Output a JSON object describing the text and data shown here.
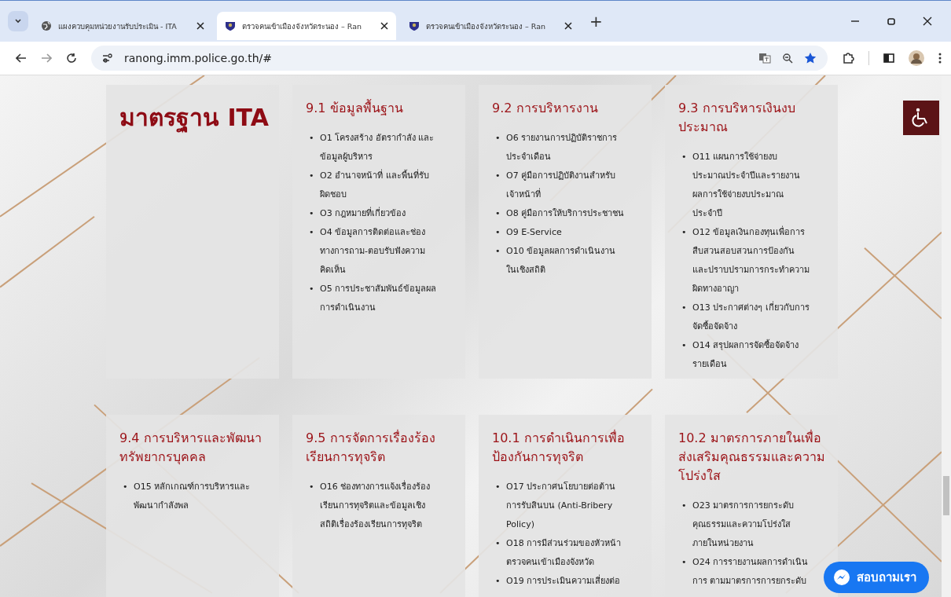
{
  "browser": {
    "tabs": [
      {
        "title": "แผงควบคุมหน่วยงานรับประเมิน - ITA",
        "selected": false,
        "kind": "globe"
      },
      {
        "title": "ตรวจคนเข้าเมืองจังหวัดระนอง – Ran",
        "selected": true,
        "kind": "shield"
      },
      {
        "title": "ตรวจคนเข้าเมืองจังหวัดระนอง – Ran",
        "selected": false,
        "kind": "shield"
      }
    ],
    "new_tab": "+",
    "address": "ranong.imm.police.go.th/#"
  },
  "page": {
    "headline": "มาตรฐาน ITA",
    "cards": [
      {
        "title": "9.1 ข้อมูลพื้นฐาน",
        "items": [
          [
            "O1 โครงสร้าง อัตรากำลัง และ",
            "ข้อมูลผู้บริหาร"
          ],
          [
            "O2 อำนาจหน้าที่ และพื้นที่รับ",
            "ผิดชอบ"
          ],
          [
            "O3 กฎหมายที่เกี่ยวข้อง"
          ],
          [
            "O4 ข้อมูลการติดต่อและช่อง",
            "ทางการถาม-ตอบรับฟังความ",
            "คิดเห็น"
          ],
          [
            "O5 การประชาสัมพันธ์ข้อมูลผล",
            "การดำเนินงาน"
          ]
        ]
      },
      {
        "title": "9.2 การบริหารงาน",
        "items": [
          [
            "O6 รายงานการปฏิบัติราชการ",
            "ประจำเดือน"
          ],
          [
            "O7 คู่มือการปฏิบัติงานสำหรับ",
            "เจ้าหน้าที่"
          ],
          [
            "O8 คู่มือการให้บริการประชาชน"
          ],
          [
            "O9 E-Service"
          ],
          [
            "O10 ข้อมูลผลการดำเนินงาน",
            "ในเชิงสถิติ"
          ]
        ]
      },
      {
        "title": "9.3 การบริหารเงินงบประมาณ",
        "items": [
          [
            "O11 แผนการใช้จ่ายงบ",
            "ประมาณประจำปีและรายงาน",
            "ผลการใช้จ่ายงบประมาณ",
            "ประจำปี"
          ],
          [
            "O12 ข้อมูลเงินกองทุนเพื่อการ",
            "สืบสวนสอบสวนการป้องกัน",
            "และปราบปรามการกระทำความ",
            "ผิดทางอาญา"
          ],
          [
            "O13 ประกาศต่างๆ เกี่ยวกับการ",
            "จัดซื้อจัดจ้าง"
          ],
          [
            "O14 สรุปผลการจัดซื้อจัดจ้าง",
            "รายเดือน"
          ]
        ]
      },
      {
        "title": "9.4 การบริหารและพัฒนาทรัพยากรบุคคล",
        "items": [
          [
            "O15 หลักเกณฑ์การบริหารและ",
            "พัฒนากำลังพล"
          ]
        ]
      },
      {
        "title": "9.5 การจัดการเรื่องร้องเรียนการทุจริต",
        "items": [
          [
            "O16 ช่องทางการแจ้งเรื่องร้อง",
            "เรียนการทุจริตและข้อมูลเชิง",
            "สถิติเรื่องร้องเรียนการทุจริต"
          ]
        ]
      },
      {
        "title": "10.1 การดำเนินการเพื่อป้องกันการทุจริต",
        "items": [
          [
            "O17 ประกาศนโยบายต่อต้าน",
            "การรับสินบน (Anti-Bribery",
            "Policy)"
          ],
          [
            "O18 การมีส่วนร่วมของหัวหน้า",
            "ตรวจคนเข้าเมืองจังหวัด"
          ],
          [
            "O19 การประเมินความเสี่ยงต่อ"
          ]
        ]
      },
      {
        "title": "10.2 มาตรการภายในเพื่อส่งเสริมคุณธรรมและความโปร่งใส",
        "items": [
          [
            "O23 มาตรการการยกระดับ",
            "คุณธรรมและความโปร่งใส",
            "ภายในหน่วยงาน"
          ],
          [
            "O24 การรายงานผลการดำเนิน",
            "การ ตามมาตรการการยกระดับ"
          ]
        ]
      }
    ],
    "bullet": "•",
    "chat_button": "สอบถามเรา"
  }
}
